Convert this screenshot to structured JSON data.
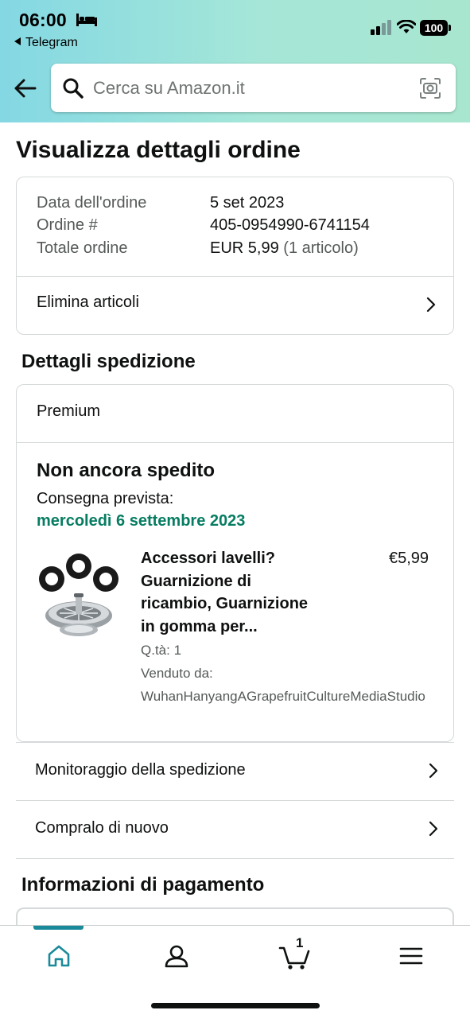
{
  "status_bar": {
    "time": "06:00",
    "back_app": "Telegram",
    "battery": "100"
  },
  "search": {
    "placeholder": "Cerca su Amazon.it"
  },
  "page": {
    "title": "Visualizza dettagli ordine"
  },
  "order_summary": {
    "date_label": "Data dell'ordine",
    "date_value": "5 set 2023",
    "order_label": "Ordine #",
    "order_value": "405-0954990-6741154",
    "total_label": "Totale ordine",
    "total_value": "EUR 5,99",
    "total_items": "(1 articolo)",
    "delete_items": "Elimina articoli"
  },
  "shipping": {
    "section_title": "Dettagli spedizione",
    "shipping_type": "Premium",
    "status": "Non ancora spedito",
    "delivery_label": "Consegna prevista:",
    "delivery_date": "mercoledì 6 settembre 2023",
    "delivery_date_color": "#067d62",
    "product": {
      "title_lines": [
        "Accessori lavelli?",
        "Guarnizione di",
        "ricambio, Guarnizione",
        "in gomma per..."
      ],
      "price": "€5,99",
      "quantity": "Q.tà: 1",
      "sold_by_label": "Venduto da:",
      "seller": "WuhanHanyangAGrapefruitCultureMediaStudio",
      "image_icon": "sink-strainer-with-rubber-gaskets"
    },
    "tracking": "Monitoraggio della spedizione",
    "buy_again": "Compralo di nuovo"
  },
  "payment": {
    "section_title": "Informazioni di pagamento"
  },
  "bottom_nav": {
    "items": [
      {
        "icon": "home-icon",
        "active": true
      },
      {
        "icon": "account-icon",
        "active": false
      },
      {
        "icon": "cart-icon",
        "active": false,
        "count": "1"
      },
      {
        "icon": "menu-icon",
        "active": false
      }
    ],
    "accent_color": "#1a8a9a"
  }
}
